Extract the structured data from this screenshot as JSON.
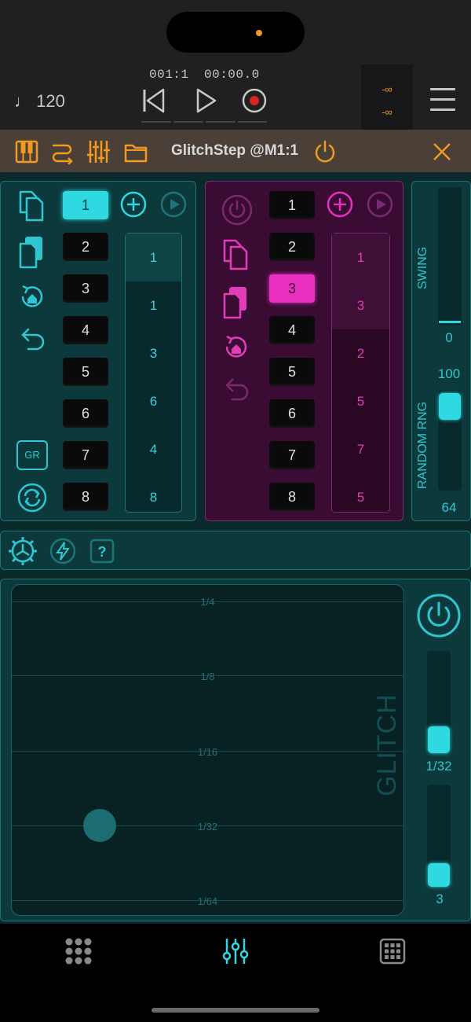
{
  "transport": {
    "tempo": "♩ 120",
    "bar_position": "001:1",
    "time_position": "00:00.0",
    "meter_left": "-∞",
    "meter_right": "-∞"
  },
  "plugin": {
    "title": "GlitchStep @M1:1"
  },
  "slots_cyan": {
    "s1": "1",
    "s2": "2",
    "s3": "3",
    "s4": "4",
    "s5": "5",
    "s6": "6",
    "s7": "7",
    "s8": "8",
    "selected": "1"
  },
  "seq_cyan": {
    "c1": "1",
    "c2": "1",
    "c3": "3",
    "c4": "6",
    "c5": "4",
    "c6": "8"
  },
  "gr_label": "GR",
  "slots_pink": {
    "s1": "1",
    "s2": "2",
    "s3": "3",
    "s4": "4",
    "s5": "5",
    "s6": "6",
    "s7": "7",
    "s8": "8",
    "selected": "3"
  },
  "seq_pink": {
    "c1": "1",
    "c2": "3",
    "c3": "2",
    "c4": "5",
    "c5": "7",
    "c6": "5"
  },
  "swing": {
    "label": "SWING",
    "value": "0",
    "level": 0
  },
  "random_rng": {
    "label": "RANDOM RNG",
    "max_value": "100",
    "value": "64",
    "level": 0.64
  },
  "pad": {
    "grid_labels": {
      "l1": "1/4",
      "l2": "1/8",
      "l3": "1/16",
      "l4": "1/32",
      "l5": "1/64"
    },
    "watermark": "GLITCH"
  },
  "glitch_controls": {
    "division_value": "1/32",
    "repeat_value": "3"
  },
  "colors": {
    "accent_cyan": "#2fd9e2",
    "accent_pink": "#e82fbf",
    "accent_orange": "#f39a1e"
  },
  "icons": {
    "toolbar": [
      "gear-icon",
      "lightning-icon",
      "help-icon"
    ],
    "tabs": [
      "pads-grid-icon",
      "mixer-icon",
      "keypad-icon"
    ]
  }
}
